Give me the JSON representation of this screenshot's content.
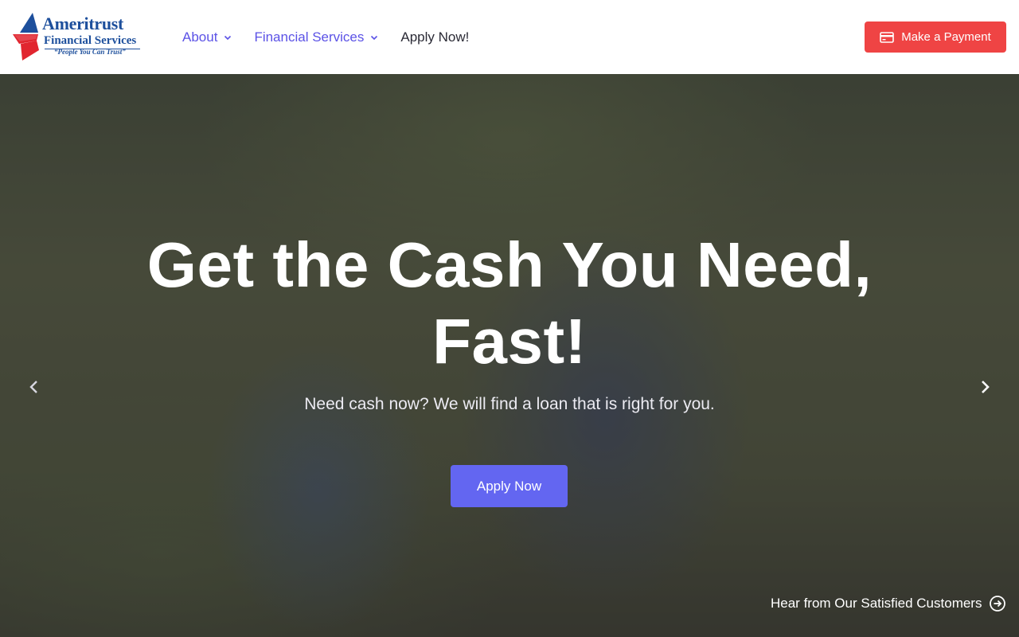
{
  "brand": {
    "name_line1": "Ameritrust",
    "name_line2": "Financial Services",
    "tagline": "“People You Can Trust”",
    "colors": {
      "blue": "#1d4f9c",
      "red": "#e1252f"
    }
  },
  "nav": {
    "items": [
      {
        "label": "About",
        "has_dropdown": true
      },
      {
        "label": "Financial Services",
        "has_dropdown": true
      },
      {
        "label": "Apply Now!",
        "has_dropdown": false
      }
    ],
    "link_color": "#5b52e6"
  },
  "header": {
    "payment_button": {
      "label": "Make a Payment",
      "icon": "credit-card-icon",
      "color": "#ef4444"
    }
  },
  "hero": {
    "title": "Get the Cash You Need, Fast!",
    "subtitle": "Need cash now? We will find a loan that is right for you.",
    "cta_label": "Apply Now",
    "cta_color": "#6366f1",
    "prev_icon": "chevron-left-icon",
    "next_icon": "chevron-right-icon",
    "testimonial_link": {
      "label": "Hear from Our Satisfied Customers",
      "icon": "arrow-right-circle-icon"
    }
  }
}
